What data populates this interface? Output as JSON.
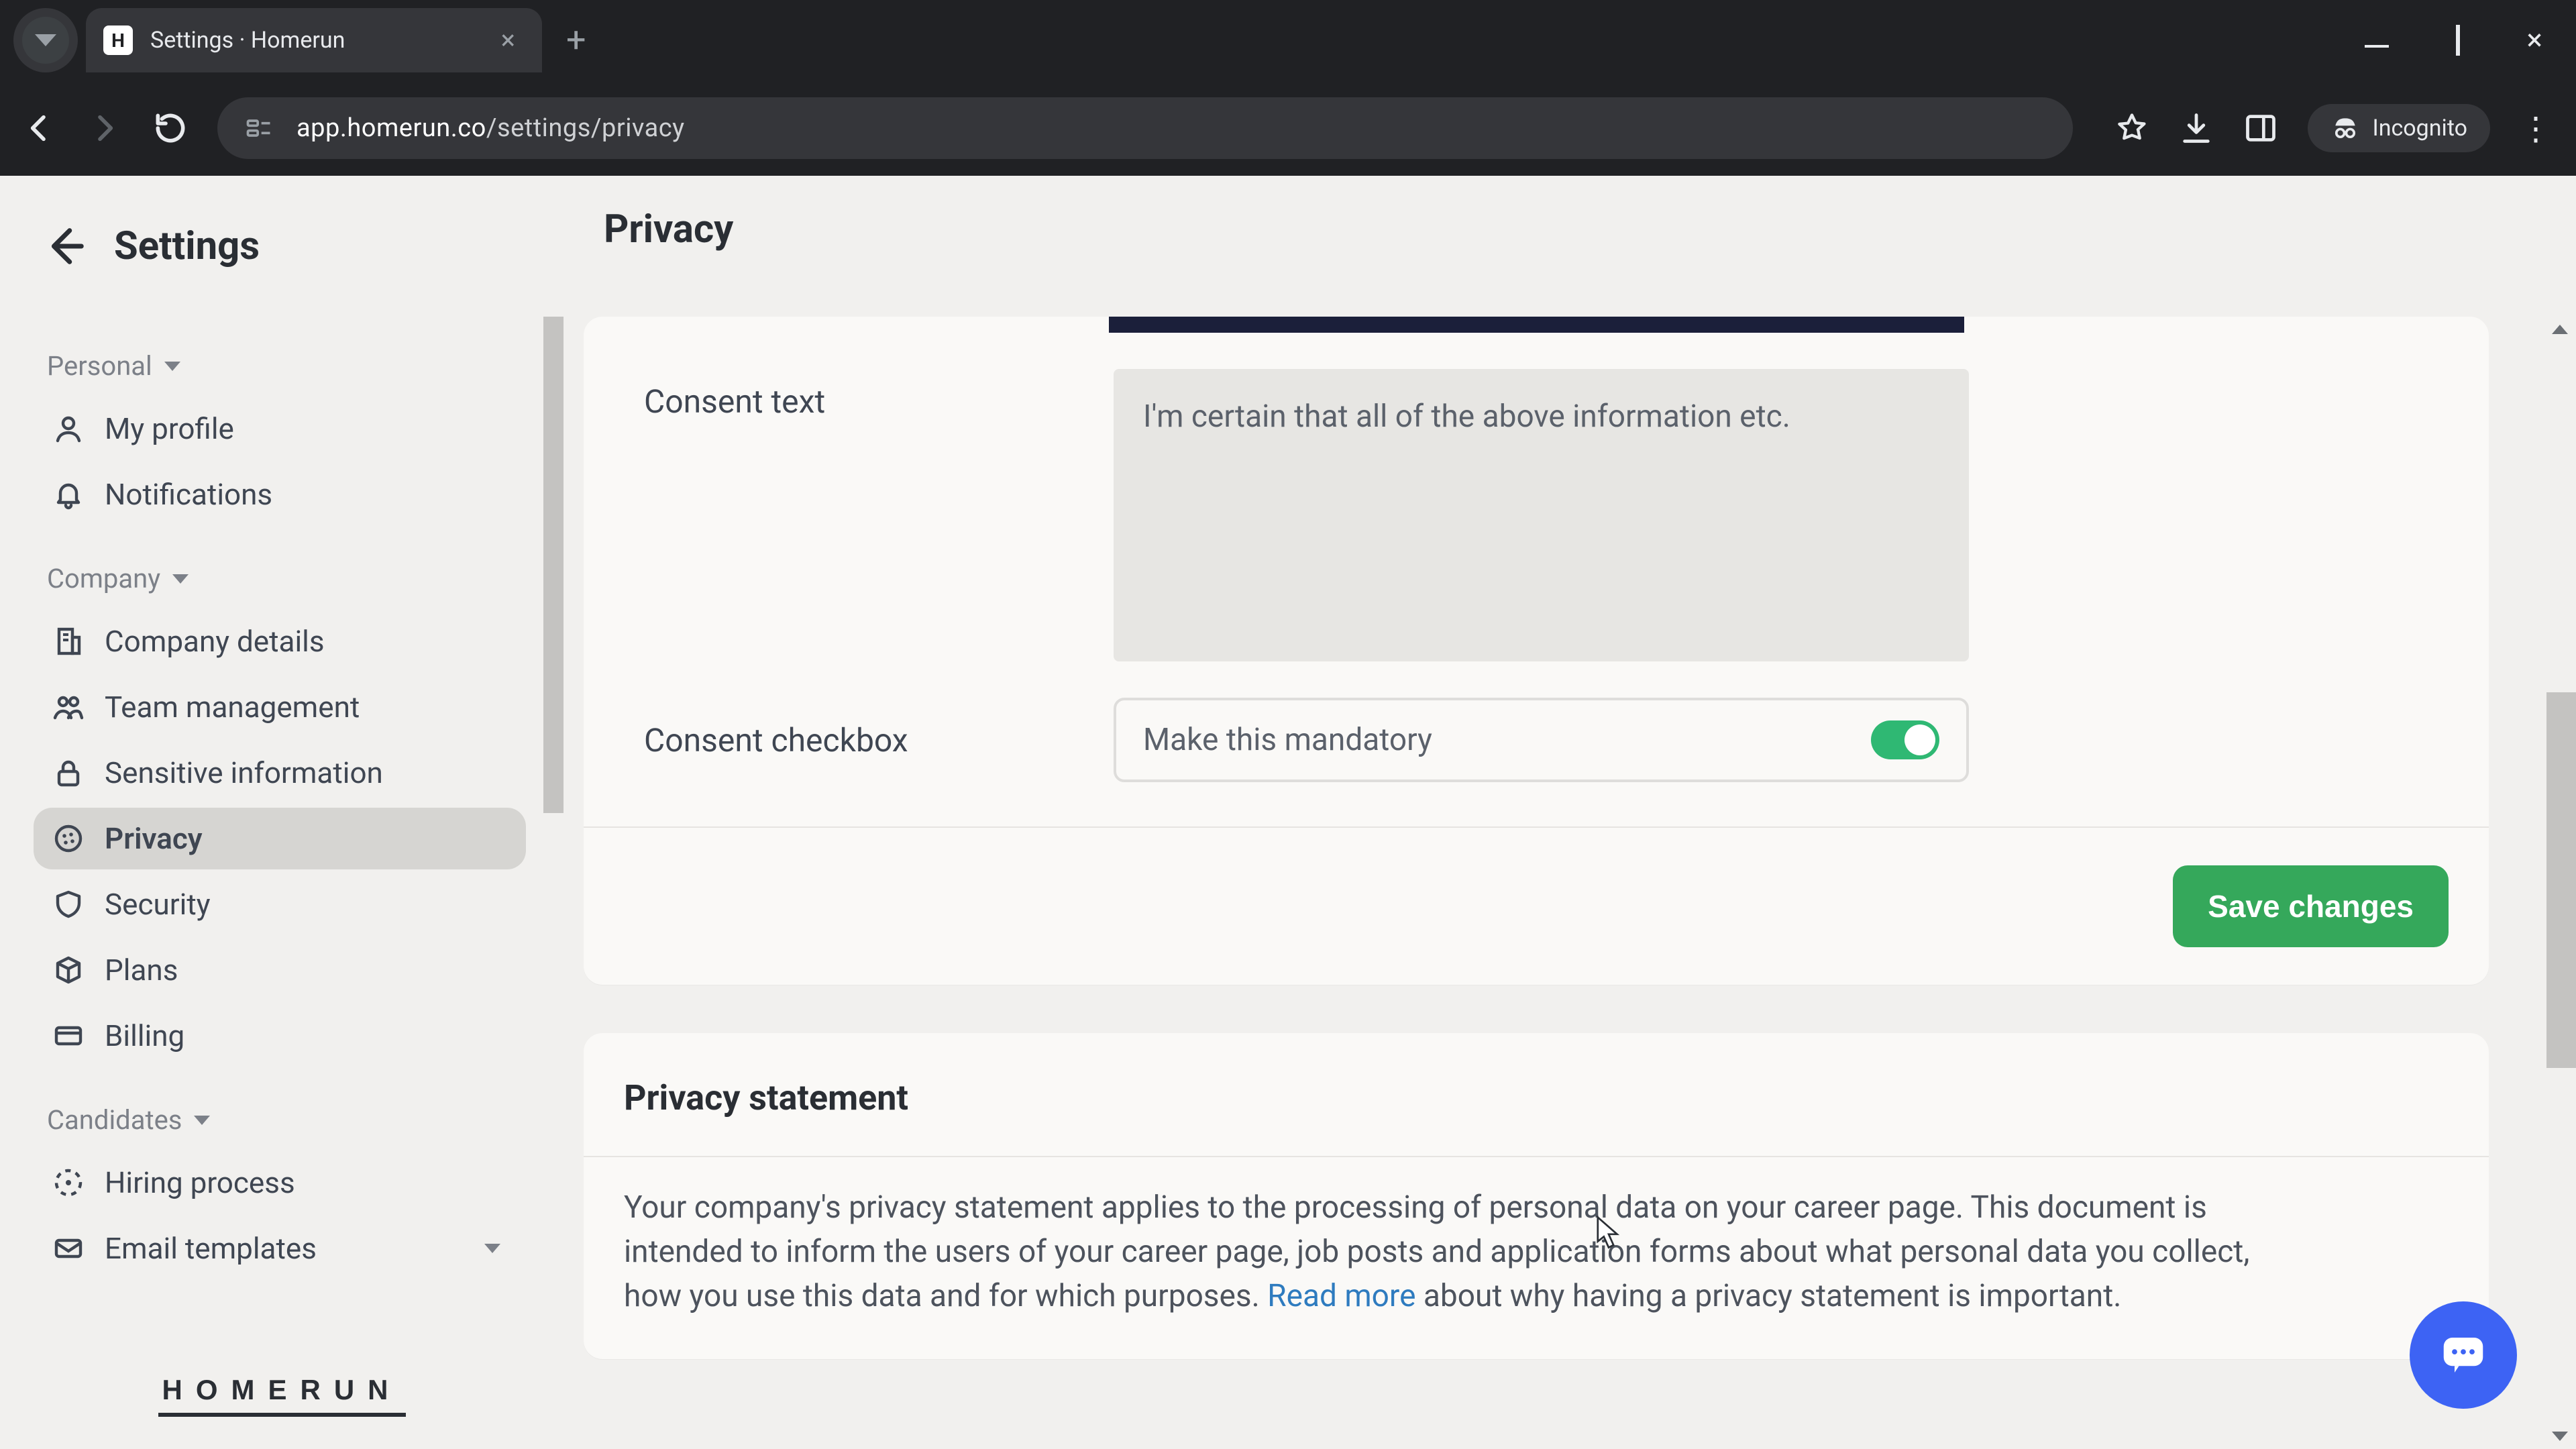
{
  "browser": {
    "tab_title": "Settings · Homerun",
    "favicon_letter": "H",
    "url_domain": "app.homerun.co",
    "url_path": "/settings/privacy",
    "incognito_label": "Incognito"
  },
  "header": {
    "settings_label": "Settings",
    "page_title": "Privacy"
  },
  "sidebar": {
    "sections": {
      "personal": {
        "label": "Personal",
        "items": [
          {
            "label": "My profile"
          },
          {
            "label": "Notifications"
          }
        ]
      },
      "company": {
        "label": "Company",
        "items": [
          {
            "label": "Company details"
          },
          {
            "label": "Team management"
          },
          {
            "label": "Sensitive information"
          },
          {
            "label": "Privacy"
          },
          {
            "label": "Security"
          },
          {
            "label": "Plans"
          },
          {
            "label": "Billing"
          }
        ]
      },
      "candidates": {
        "label": "Candidates",
        "items": [
          {
            "label": "Hiring process"
          },
          {
            "label": "Email templates"
          }
        ]
      }
    },
    "footer_logo": "HOMERUN"
  },
  "consent": {
    "text_label": "Consent text",
    "text_value": "I'm certain that all of the above information etc.",
    "checkbox_label": "Consent checkbox",
    "checkbox_control_label": "Make this mandatory",
    "checkbox_on": true,
    "save_label": "Save changes"
  },
  "privacy_statement": {
    "heading": "Privacy statement",
    "body_pre": "Your company's privacy statement applies to the processing of personal data on your career page. This document is intended to inform the users of your career page, job posts and application forms about what personal data you collect, how you use this data and for which purposes. ",
    "read_more": "Read more",
    "body_post": " about why having a privacy statement is important."
  }
}
